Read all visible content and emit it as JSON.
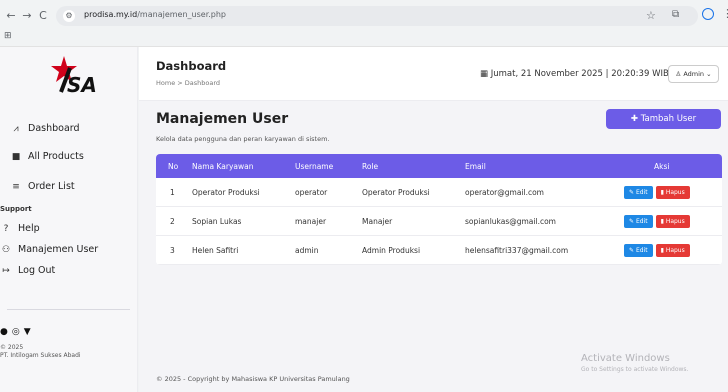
{
  "browser": {
    "url_host": "prodisa.my.id",
    "url_path": "/manajemen_user.php"
  },
  "sidebar": {
    "items": [
      {
        "label": "Dashboard",
        "icon": "chart-line-icon"
      },
      {
        "label": "All Products",
        "icon": "box-icon"
      },
      {
        "label": "Order List",
        "icon": "list-icon"
      }
    ],
    "support_heading": "Support",
    "support_items": [
      {
        "label": "Help",
        "icon": "help-circle-icon"
      },
      {
        "label": "Manajemen User",
        "icon": "users-icon"
      },
      {
        "label": "Log Out",
        "icon": "logout-icon"
      }
    ],
    "social_icons": [
      "facebook-icon",
      "instagram-icon",
      "twitter-icon"
    ],
    "copyright_year": "© 2025",
    "company": "PT. Intilogam Sukses Abadi"
  },
  "header": {
    "title": "Dashboard",
    "breadcrumb": "Home > Dashboard",
    "datetime": "Jumat, 21 November 2025 | 20:20:39 WIB",
    "user_menu": "Admin"
  },
  "page": {
    "title": "Manajemen User",
    "description": "Kelola data pengguna dan peran karyawan di sistem.",
    "add_button": "Tambah User"
  },
  "table": {
    "columns": [
      "No",
      "Nama Karyawan",
      "Username",
      "Role",
      "Email",
      "Aksi"
    ],
    "rows": [
      {
        "no": "1",
        "nama": "Operator Produksi",
        "username": "operator",
        "role": "Operator Produksi",
        "email": "operator@gmail.com"
      },
      {
        "no": "2",
        "nama": "Sopian Lukas",
        "username": "manajer",
        "role": "Manajer",
        "email": "sopianlukas@gmail.com"
      },
      {
        "no": "3",
        "nama": "Helen Safitri",
        "username": "admin",
        "role": "Admin Produksi",
        "email": "helensafitri337@gmail.com"
      }
    ],
    "edit_label": "Edit",
    "delete_label": "Hapus"
  },
  "footer": "© 2025 - Copyright by Mahasiswa KP Universitas Pamulang",
  "watermark": {
    "line1": "Activate Windows",
    "line2": "Go to Settings to activate Windows."
  },
  "colors": {
    "accent": "#6c5ce7",
    "edit": "#1e88e5",
    "delete": "#e53935"
  }
}
